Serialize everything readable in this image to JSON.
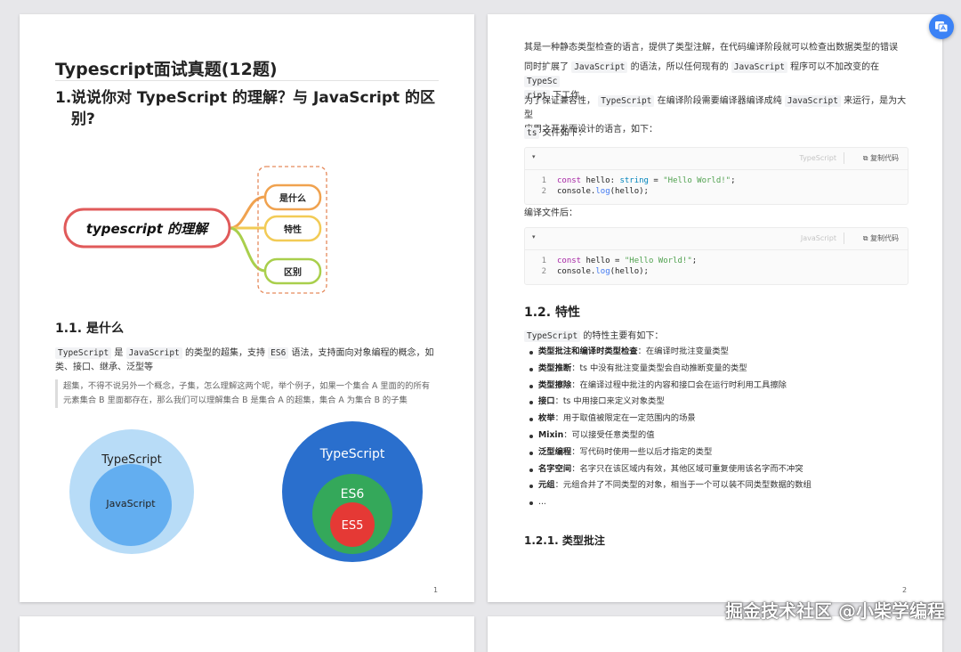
{
  "page1": {
    "doc_title": "Typescript面试真题(12题)",
    "h1_num": "1.",
    "h1_line1": "说说你对 TypeScript 的理解？与 JavaScript 的区",
    "h1_line2": "别?",
    "mindmap": {
      "center": "typescript 的理解",
      "items": [
        "是什么",
        "特性",
        "区别"
      ]
    },
    "s11_title": "1.1. 是什么",
    "s11_p": {
      "c1": "TypeScript",
      "t1": "是",
      "c2": "JavaScript",
      "t2": "的类型的超集，支持",
      "c3": "ES6",
      "t3": "语法，支持面向对象编程的概念，如",
      "line2": "类、接口、继承、泛型等"
    },
    "quote_l1": "超集，不得不说另外一个概念，子集，怎么理解这两个呢，举个例子，如果一个集合 A 里面的的所有",
    "quote_l2": "元素集合 B 里面都存在，那么我们可以理解集合 B 是集合 A 的超集，集合 A 为集合 B 的子集",
    "venn1": {
      "outer": "TypeScript",
      "inner": "JavaScript"
    },
    "venn2": {
      "outer": "TypeScript",
      "mid": "ES6",
      "inner": "ES5"
    },
    "page_num": "1"
  },
  "page2": {
    "p1": "其是一种静态类型检查的语言，提供了类型注解，在代码编译阶段就可以检查出数据类型的错误",
    "p2": {
      "t1": "同时扩展了",
      "c1": "JavaScript",
      "t2": "的语法，所以任何现有的",
      "c2": "JavaScript",
      "t3": "程序可以不加改变的在",
      "c3a": "TypeSc",
      "c3b": "ript",
      "t4": "下工作"
    },
    "p3": {
      "t1": "为了保证兼容性，",
      "c1": "TypeScript",
      "t2": "在编译阶段需要编译器编译成纯",
      "c2": "JavaScript",
      "t3": "来运行，是为大型",
      "line2": "应用之开发而设计的语言，如下："
    },
    "p4": {
      "c1": "ts",
      "t1": "文件如下："
    },
    "code1": {
      "lang": "TypeScript",
      "copy": "复制代码",
      "line1_no": "1",
      "line1_kw": "const",
      "line1_a": " hello: ",
      "line1_type": "string",
      "line1_b": " = ",
      "line1_str": "\"Hello World!\"",
      "line1_end": ";",
      "line2_no": "2",
      "line2_a": "console.",
      "line2_fn": "log",
      "line2_b": "(hello);"
    },
    "p5": "编译文件后：",
    "code2": {
      "lang": "JavaScript",
      "copy": "复制代码",
      "line1_no": "1",
      "line1_kw": "const",
      "line1_a": " hello = ",
      "line1_str": "\"Hello World!\"",
      "line1_end": ";",
      "line2_no": "2",
      "line2_a": "console.",
      "line2_fn": "log",
      "line2_b": "(hello);"
    },
    "s12_title": "1.2. 特性",
    "s12_p": {
      "c1": "TypeScript",
      "t1": "的特性主要有如下："
    },
    "features": [
      {
        "term": "类型批注和编译时类型检查",
        "desc": "：在编译时批注变量类型"
      },
      {
        "term": "类型推断",
        "desc": "：ts 中没有批注变量类型会自动推断变量的类型"
      },
      {
        "term": "类型擦除",
        "desc": "：在编译过程中批注的内容和接口会在运行时利用工具擦除"
      },
      {
        "term": "接口",
        "desc": "：ts 中用接口来定义对象类型"
      },
      {
        "term": "枚举",
        "desc": "：用于取值被限定在一定范围内的场景"
      },
      {
        "term": "Mixin",
        "desc": "：可以接受任意类型的值"
      },
      {
        "term": "泛型编程",
        "desc": "：写代码时使用一些以后才指定的类型"
      },
      {
        "term": "名字空间",
        "desc": "：名字只在该区域内有效，其他区域可重复使用该名字而不冲突"
      },
      {
        "term": "元组",
        "desc": "：元组合并了不同类型的对象，相当于一个可以装不同类型数据的数组"
      },
      {
        "term": "",
        "desc": "..."
      }
    ],
    "s121_title": "1.2.1. 类型批注",
    "page_num": "2"
  },
  "watermark": "掘金技术社区 @小柴学编程",
  "colors": {
    "mindmap_red": "#e05a5a",
    "mindmap_orange": "#f0a24f",
    "mindmap_yellow": "#f2cb56",
    "mindmap_green": "#a9cf4c",
    "venn_light": "#b8dcf7",
    "venn_mid": "#63aef0",
    "venn_dark_blue": "#2a6fcd",
    "venn_green": "#34a85a",
    "venn_red": "#e53935"
  }
}
